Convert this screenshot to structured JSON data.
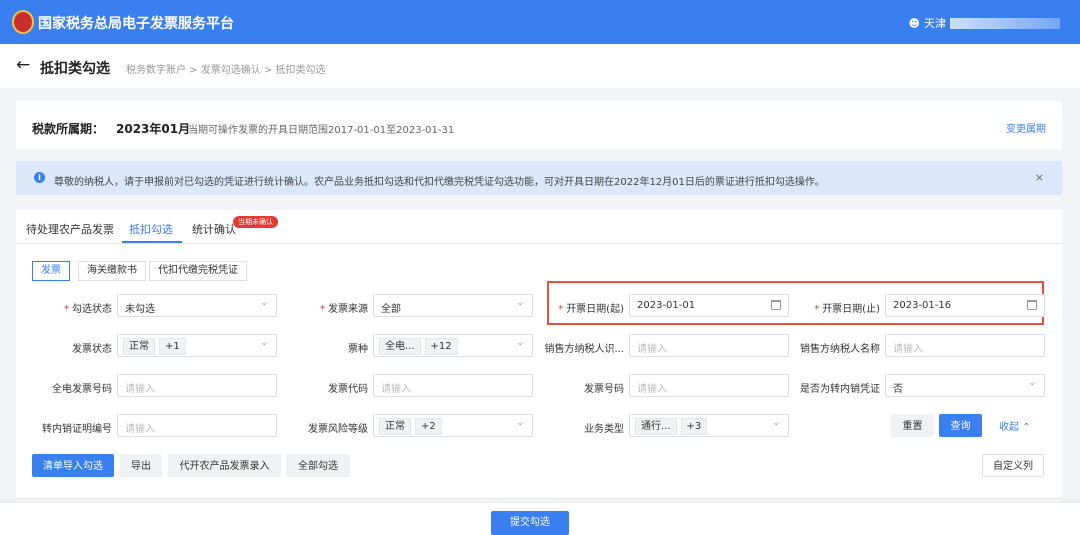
{
  "header": {
    "title": "国家税务总局电子发票服务平台",
    "user": "天津"
  },
  "breadcrumb": {
    "back": "←",
    "title": "抵扣类勾选",
    "path": "税务数字账户 > 发票勾选确认 > 抵扣类勾选"
  },
  "period": {
    "label": "税款所属期：",
    "value": "2023年01月",
    "range": "当期可操作发票的开具日期范围2017-01-01至2023-01-31",
    "change": "变更属期"
  },
  "notice": {
    "icon": "info-icon",
    "text": "尊敬的纳税人，请于申报前对已勾选的凭证进行统计确认。农产品业务抵扣勾选和代扣代缴完税凭证勾选功能，可对开具日期在2022年12月01日后的票证进行抵扣勾选操作。",
    "close": "×"
  },
  "tabs": [
    {
      "label": "待处理农产品发票"
    },
    {
      "label": "抵扣勾选"
    },
    {
      "label": "统计确认"
    }
  ],
  "tab_badge": "当期未确认",
  "subtabs": [
    {
      "label": "发票"
    },
    {
      "label": "海关缴款书"
    },
    {
      "label": "代扣代缴完税凭证"
    }
  ],
  "form": {
    "check_status": {
      "label": "勾选状态",
      "value": "未勾选"
    },
    "invoice_source": {
      "label": "发票来源",
      "value": "全部"
    },
    "date_start": {
      "label": "开票日期(起)",
      "value": "2023-01-01"
    },
    "date_end": {
      "label": "开票日期(止)",
      "value": "2023-01-16"
    },
    "invoice_status": {
      "label": "发票状态",
      "tag1": "正常",
      "tag2": "+1"
    },
    "invoice_type": {
      "label": "票种",
      "tag1": "全电...",
      "tag2": "+12"
    },
    "seller_taxid": {
      "label": "销售方纳税人识...",
      "placeholder": "请输入"
    },
    "seller_name": {
      "label": "销售方纳税人名称",
      "placeholder": "请输入"
    },
    "einvoice_no": {
      "label": "全电发票号码",
      "placeholder": "请输入"
    },
    "invoice_code": {
      "label": "发票代码",
      "placeholder": "请输入"
    },
    "invoice_no": {
      "label": "发票号码",
      "placeholder": "请输入"
    },
    "transfer_voucher": {
      "label": "是否为转内销凭证",
      "value": "否"
    },
    "transfer_cert_no": {
      "label": "转内销证明编号",
      "placeholder": "请输入"
    },
    "risk_level": {
      "label": "发票风险等级",
      "tag1": "正常",
      "tag2": "+2"
    },
    "business_type": {
      "label": "业务类型",
      "tag1": "通行...",
      "tag2": "+3"
    }
  },
  "actions": {
    "reset": "重置",
    "query": "查询",
    "collapse": "收起",
    "import": "清单导入勾选",
    "export": "导出",
    "agri_entry": "代开农产品发票录入",
    "select_all": "全部勾选",
    "custom_cols": "自定义列"
  },
  "footer": {
    "submit": "提交勾选"
  },
  "colors": {
    "primary": "#3a7ff0",
    "highlight": "#e4533c",
    "badge": "#e53935"
  }
}
